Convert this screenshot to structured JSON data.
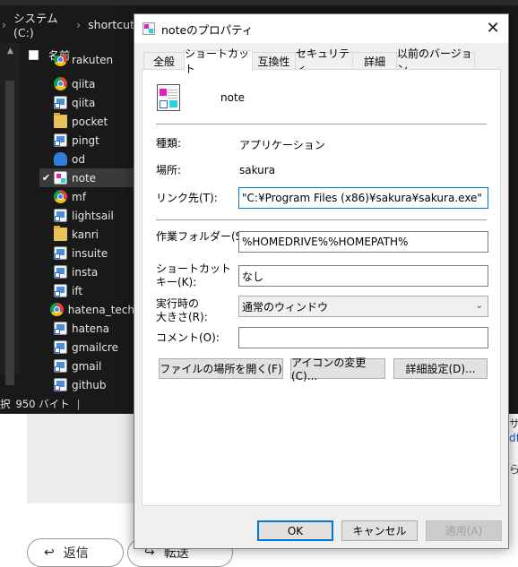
{
  "explorer": {
    "breadcrumb": [
      "システム (C:)",
      "shortcut"
    ],
    "column_header": "名前",
    "files": [
      {
        "name": "rakuten",
        "icon": "chrome-icon",
        "partial": true
      },
      {
        "name": "qiita",
        "icon": "chrome-icon"
      },
      {
        "name": "qiita",
        "icon": "shortcut-icon"
      },
      {
        "name": "pocket",
        "icon": "folder-icon"
      },
      {
        "name": "pingt",
        "icon": "shortcut-icon"
      },
      {
        "name": "od",
        "icon": "cloud-icon"
      },
      {
        "name": "note",
        "icon": "note-icon",
        "selected": true
      },
      {
        "name": "mf",
        "icon": "chrome-icon"
      },
      {
        "name": "lightsail",
        "icon": "shortcut-icon"
      },
      {
        "name": "kanri",
        "icon": "folder-icon"
      },
      {
        "name": "insuite",
        "icon": "shortcut-icon"
      },
      {
        "name": "insta",
        "icon": "shortcut-icon"
      },
      {
        "name": "ift",
        "icon": "shortcut-icon"
      },
      {
        "name": "hatena_tech",
        "icon": "chrome-icon"
      },
      {
        "name": "hatena",
        "icon": "shortcut-icon"
      },
      {
        "name": "gmailcre",
        "icon": "shortcut-icon"
      },
      {
        "name": "gmail",
        "icon": "shortcut-icon"
      },
      {
        "name": "github",
        "icon": "shortcut-icon"
      }
    ],
    "status_left": "択",
    "status_size": "950 バイト",
    "status_bar": "|"
  },
  "background": {
    "reply_button": "返信",
    "forward_button": "転送",
    "right_fragments": [
      "サ",
      "dfo",
      "ら"
    ]
  },
  "dialog": {
    "title": "noteのプロパティ",
    "tabs": [
      "全般",
      "ショートカット",
      "互換性",
      "セキュリティ",
      "詳細",
      "以前のバージョン"
    ],
    "active_tab": "ショートカット",
    "shortcut_name": "note",
    "type_label": "種類:",
    "type_value": "アプリケーション",
    "location_label": "場所:",
    "location_value": "sakura",
    "target_label": "リンク先(T):",
    "target_value": "\"C:¥Program Files (x86)¥sakura¥sakura.exe\"",
    "workdir_label": "作業フォルダー(S):",
    "workdir_value": "%HOMEDRIVE%%HOMEPATH%",
    "hotkey_label_1": "ショートカット",
    "hotkey_label_2": "キー(K):",
    "hotkey_value": "なし",
    "run_label_1": "実行時の",
    "run_label_2": "大きさ(R):",
    "run_value": "通常のウィンドウ",
    "comment_label": "コメント(O):",
    "comment_value": "",
    "open_location_button": "ファイルの場所を開く(F)",
    "change_icon_button": "アイコンの変更(C)...",
    "advanced_button": "詳細設定(D)...",
    "ok_button": "OK",
    "cancel_button": "キャンセル",
    "apply_button": "適用(A)"
  }
}
